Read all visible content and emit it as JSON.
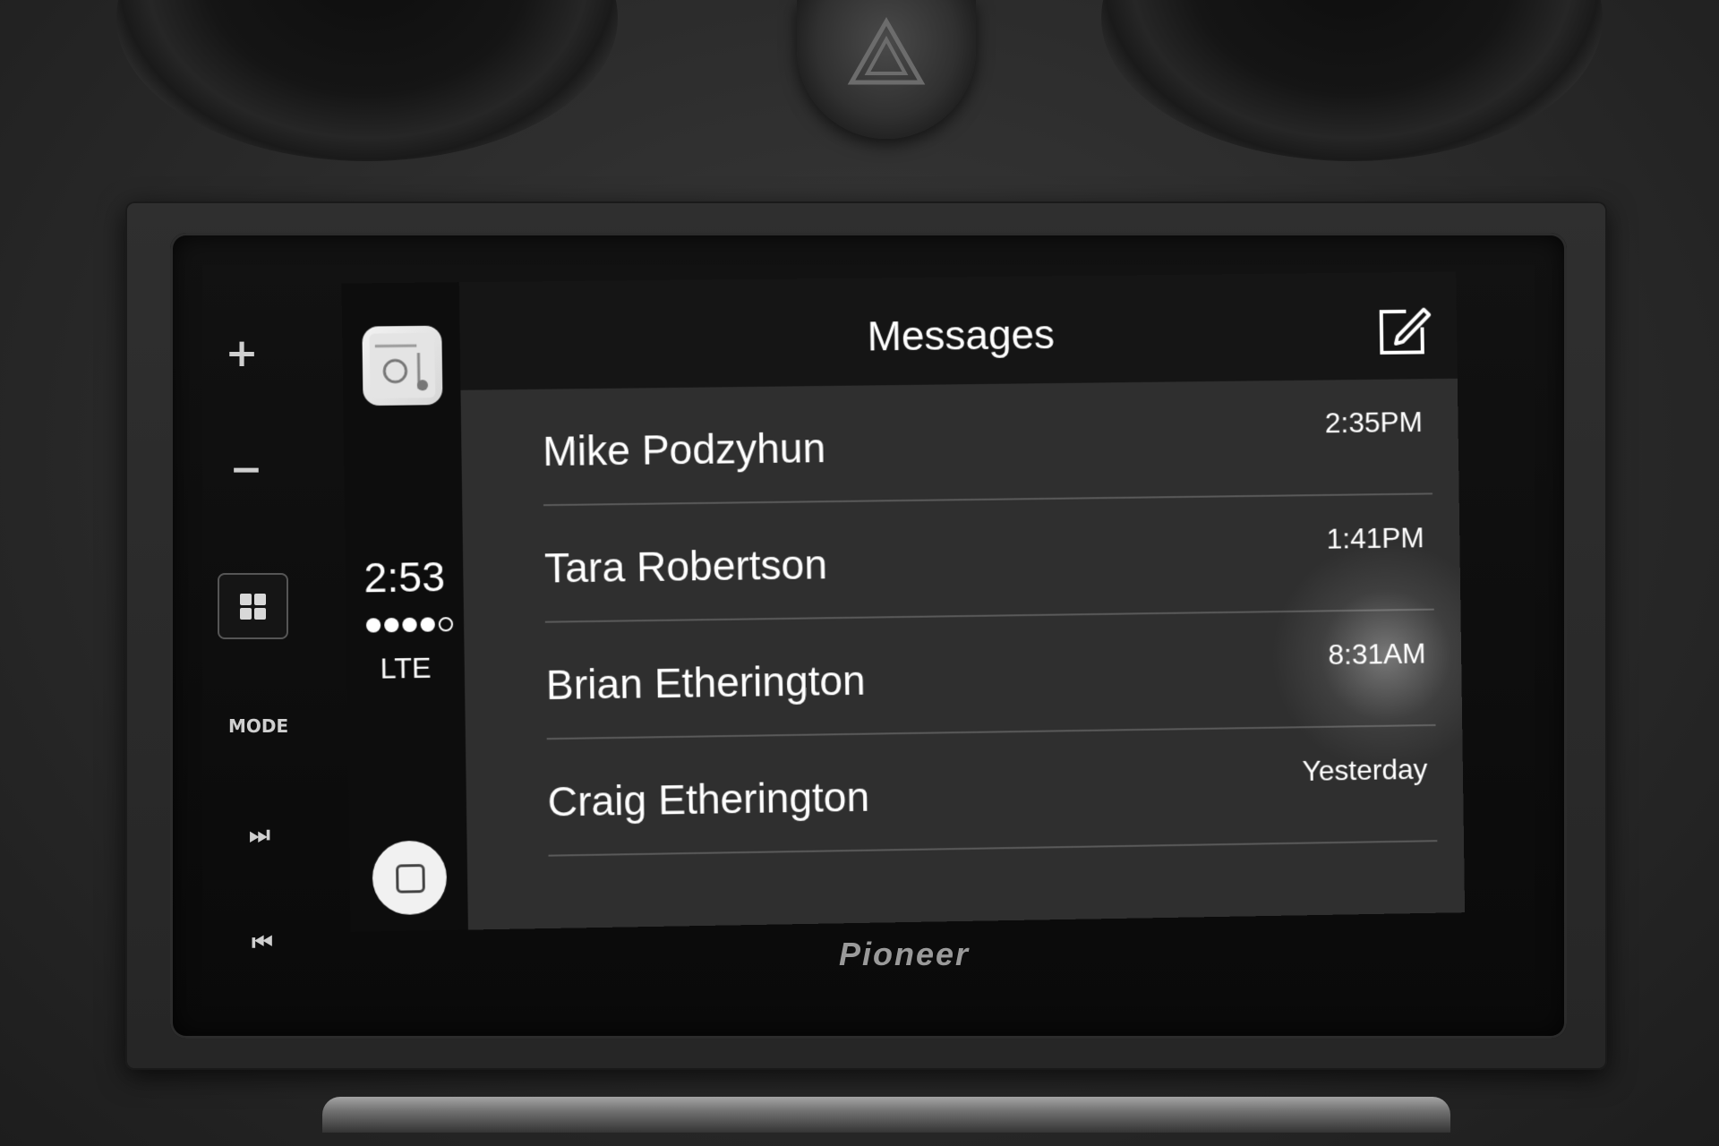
{
  "device": {
    "brand": "Pioneer",
    "buttons": {
      "volume_up": "+",
      "volume_down": "−",
      "mode": "MODE",
      "next": "⏭",
      "previous": "⏮"
    }
  },
  "status": {
    "time": "2:53",
    "network": "LTE",
    "signal_bars_filled": 4,
    "signal_bars_total": 5
  },
  "header": {
    "title": "Messages"
  },
  "conversations": [
    {
      "name": "Mike Podzyhun",
      "time": "2:35PM"
    },
    {
      "name": "Tara Robertson",
      "time": "1:41PM"
    },
    {
      "name": "Brian Etherington",
      "time": "8:31AM"
    },
    {
      "name": "Craig Etherington",
      "time": "Yesterday"
    }
  ],
  "colors": {
    "screen_background": "#151515",
    "list_background": "#2f2f2f",
    "text": "#ffffff",
    "separator": "#5a5a5a"
  }
}
